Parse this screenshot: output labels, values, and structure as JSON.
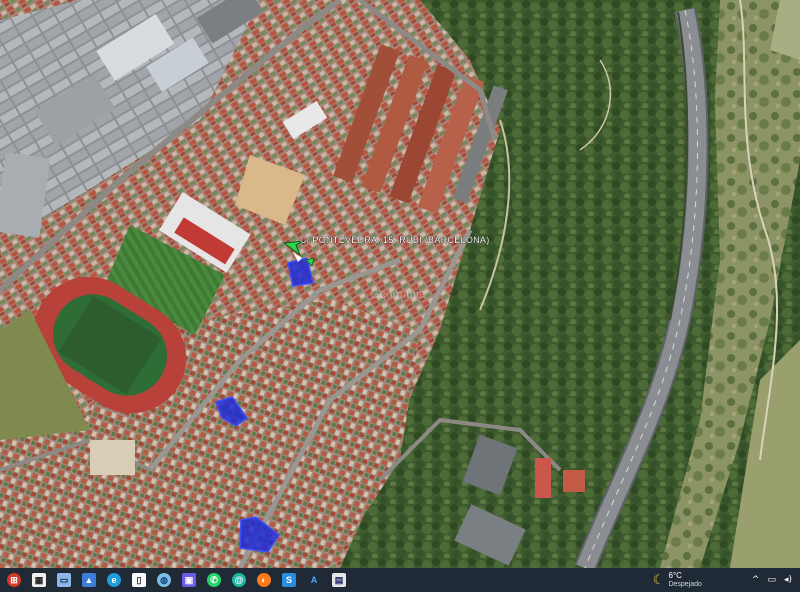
{
  "map": {
    "placemark_label": "C/ PONTEVEDRA, 15, RUBI (BARCELONA)",
    "marker_icon": "green-arrow-pin-icon",
    "parcel_color": "#1f2bd6",
    "watermark_text": "Geomania"
  },
  "taskbar": {
    "apps": [
      {
        "name": "start-button",
        "icon": "windows-logo-icon"
      },
      {
        "name": "calendar-app",
        "icon": "calendar-icon"
      },
      {
        "name": "desktop-app",
        "icon": "monitor-icon"
      },
      {
        "name": "photos-app",
        "icon": "photos-icon"
      },
      {
        "name": "edge-browser",
        "icon": "edge-icon"
      },
      {
        "name": "file-app",
        "icon": "document-icon"
      },
      {
        "name": "google-earth-app",
        "icon": "globe-icon"
      },
      {
        "name": "save-app",
        "icon": "floppy-icon"
      },
      {
        "name": "whatsapp-app",
        "icon": "whatsapp-icon"
      },
      {
        "name": "teal-app",
        "icon": "swirl-icon"
      },
      {
        "name": "firefox-app",
        "icon": "firefox-icon"
      },
      {
        "name": "s-app",
        "icon": "s-letter-icon"
      },
      {
        "name": "a-app",
        "icon": "a-letter-icon"
      },
      {
        "name": "window-app",
        "icon": "window-icon"
      }
    ],
    "weather": {
      "temperature": "6°C",
      "condition": "Despejado",
      "icon": "moon-icon"
    }
  }
}
